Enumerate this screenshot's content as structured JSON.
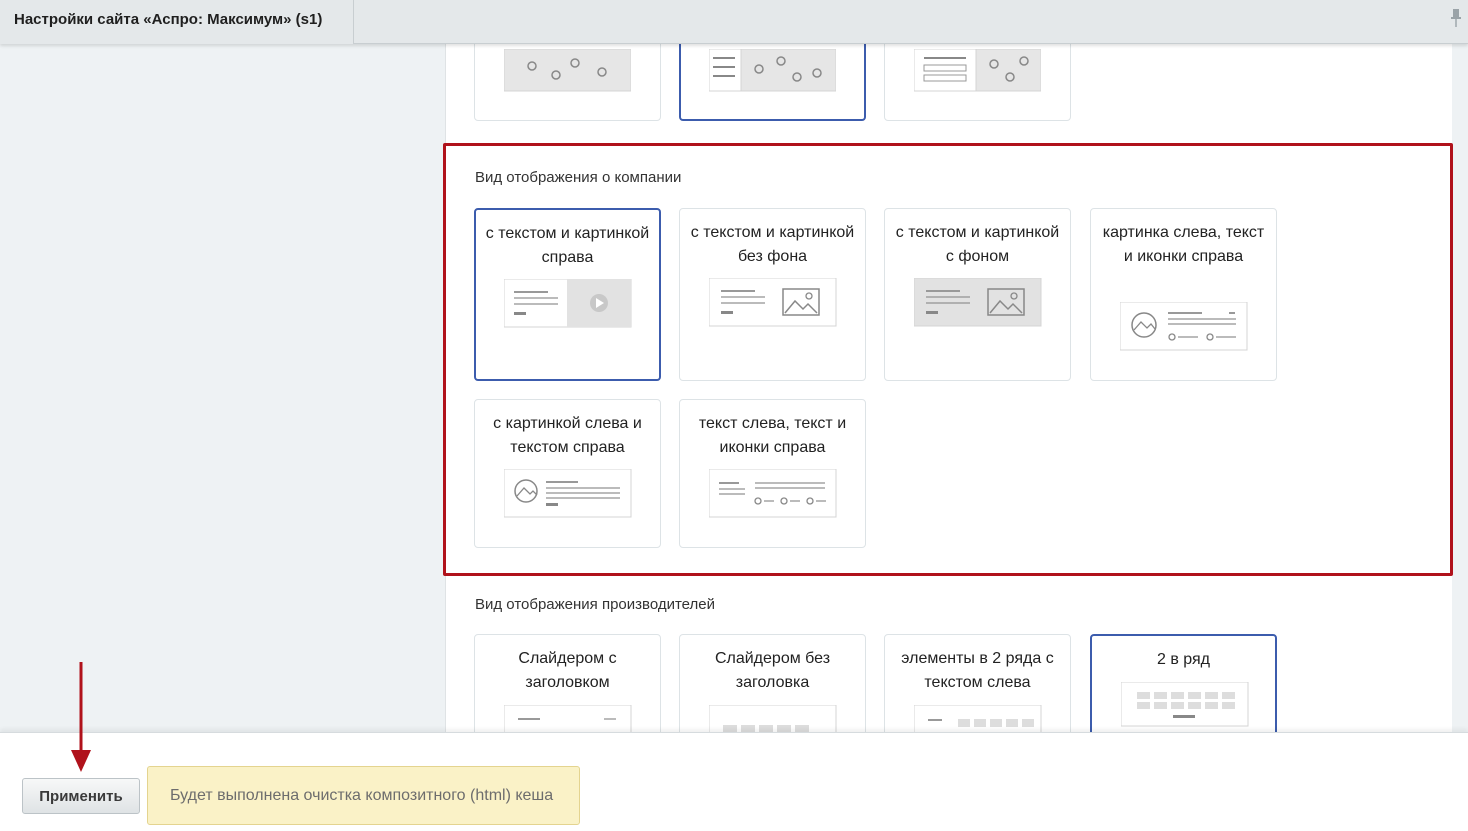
{
  "header": {
    "title": "Настройки сайта «Аспро: Максимум» (s1)"
  },
  "top_row": [
    "",
    "",
    ""
  ],
  "about_section": {
    "title": "Вид отображения о компании",
    "cards": [
      {
        "label": "с текстом и картинкой справа",
        "selected": true
      },
      {
        "label": "с текстом и картинкой без фона",
        "selected": false
      },
      {
        "label": "с текстом и картинкой с фоном",
        "selected": false
      },
      {
        "label": "картинка слева, текст и иконки справа",
        "selected": false
      },
      {
        "label": "с картинкой слева и текстом справа",
        "selected": false
      },
      {
        "label": "текст слева, текст и иконки справа",
        "selected": false
      }
    ]
  },
  "brands_section": {
    "title": "Вид отображения производителей",
    "cards": [
      {
        "label": "Слайдером с заголовком",
        "selected": false
      },
      {
        "label": "Слайдером без заголовка",
        "selected": false
      },
      {
        "label": "элементы в 2 ряда с текстом слева",
        "selected": false
      },
      {
        "label": "2 в ряд",
        "selected": true
      }
    ]
  },
  "footer": {
    "apply_label": "Применить",
    "notice": "Будет выполнена очистка композитного (html) кеша"
  },
  "colors": {
    "highlight": "#b0121b",
    "selected_border": "#3c5cad",
    "notice_bg": "#faf2c7"
  }
}
